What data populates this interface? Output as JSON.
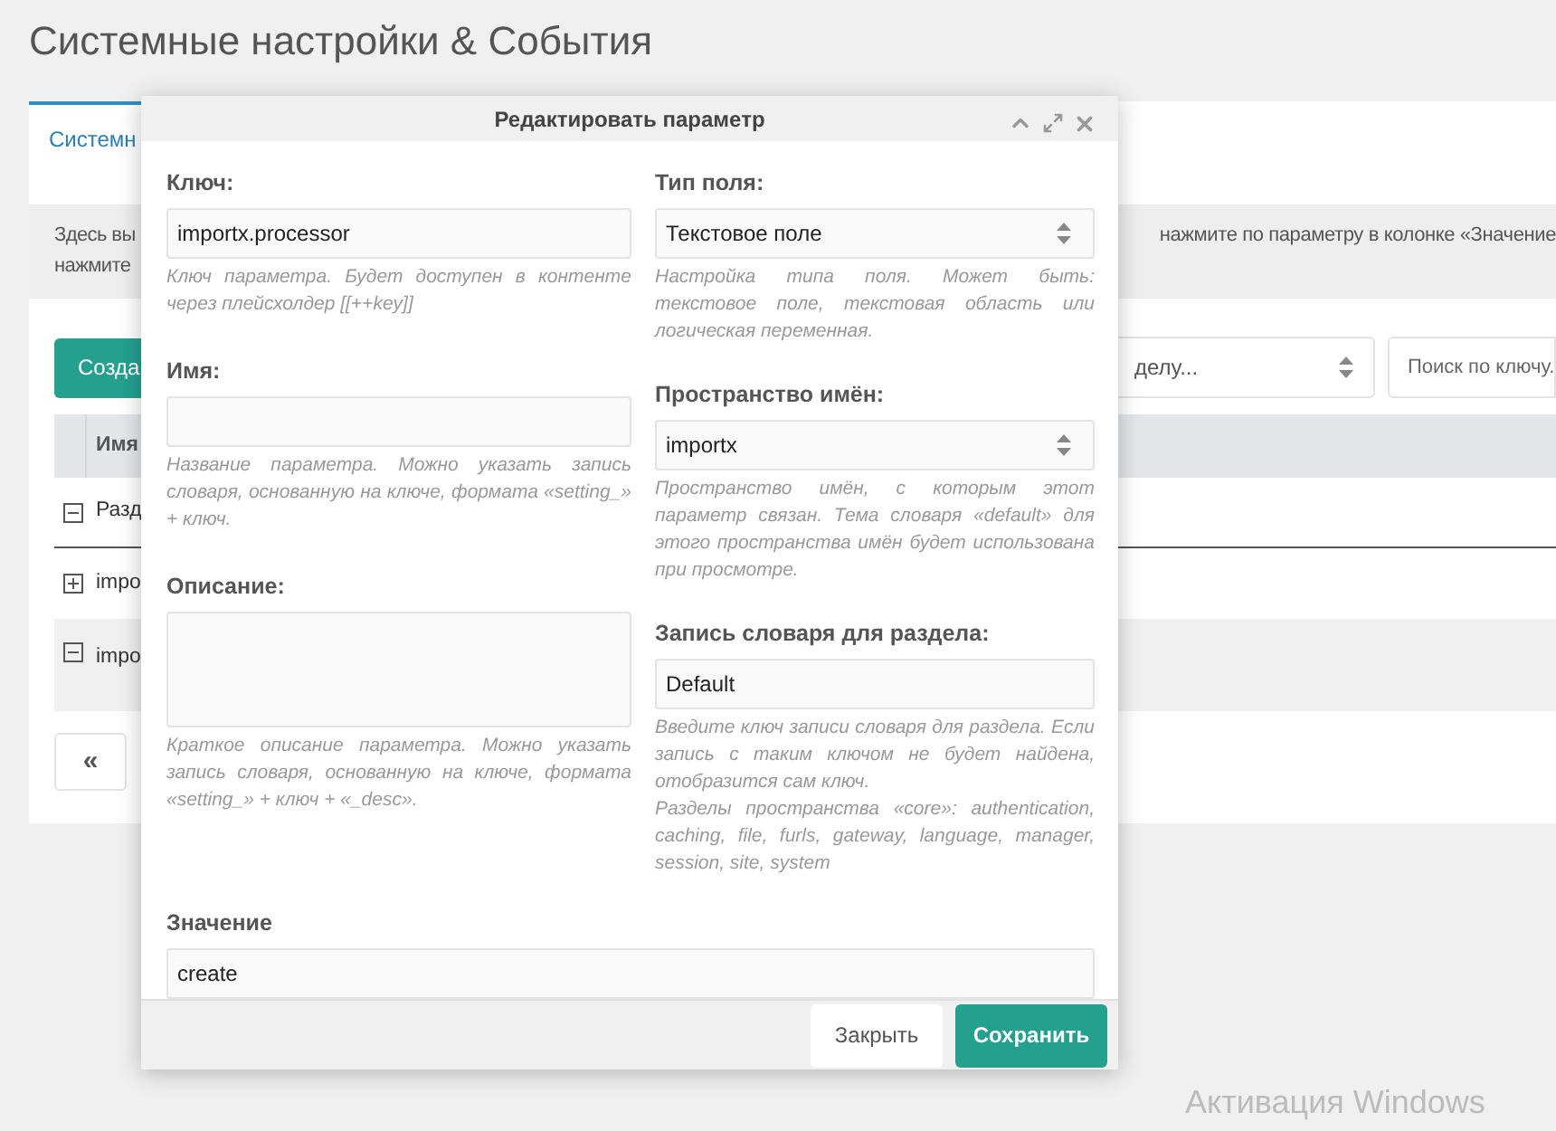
{
  "page": {
    "title": "Системные настройки & События"
  },
  "tabs": [
    {
      "label": "Системн",
      "selected": true
    }
  ],
  "description": {
    "left_lines": [
      "Здесь вы",
      "нажмите"
    ],
    "right_text": "нажмите по параметру в колонке «Значение"
  },
  "toolbar": {
    "create_button": "Созда",
    "section_select": "делу...",
    "search_placeholder": "Поиск по ключу."
  },
  "grid": {
    "columns": [
      "Имя"
    ],
    "rows": [
      {
        "label": "Разд",
        "expanded": true,
        "selected": false
      },
      {
        "label": "impo",
        "expanded": false,
        "selected": false
      },
      {
        "label": "impo",
        "expanded": true,
        "selected": true
      }
    ]
  },
  "pager": {
    "first_button": "«"
  },
  "modal": {
    "title": "Редактировать параметр",
    "left_fields": [
      {
        "label": "Ключ:",
        "kind": "input",
        "value": "importx.processor",
        "help": [
          "Ключ параметра. Будет доступен в контенте через плейсхолдер [[++key]]"
        ]
      },
      {
        "label": "Имя:",
        "kind": "input",
        "help": [
          "Название параметра. Можно указать запись словаря, основанную на ключе, формата «setting_» + ключ."
        ]
      },
      {
        "label": "Описание:",
        "kind": "textarea",
        "help": [
          "Краткое описание параметра. Можно указать запись словаря, основанную на ключе, формата «setting_» + ключ + «_desc»."
        ]
      }
    ],
    "right_fields": [
      {
        "label": "Тип поля:",
        "kind": "select",
        "value": "Текстовое поле",
        "help": [
          "Настройка типа поля. Может быть: текстовое поле, текстовая область или логическая переменная."
        ]
      },
      {
        "label": "Пространство имён:",
        "kind": "select",
        "value": "importx",
        "help": [
          "Пространство имён, с которым этот параметр связан. Тема словаря «default» для этого пространства имён будет использована при просмотре."
        ]
      },
      {
        "label": "Запись словаря для раздела:",
        "kind": "input",
        "value": "Default",
        "help": [
          "Введите ключ записи словаря для раздела. Если запись с таким ключом не будет найдена, отобразится сам ключ.",
          "Разделы пространства «core»: authentication, caching, file, furls, gateway, language, manager, session, site, system"
        ]
      }
    ],
    "value_field": {
      "label": "Значение",
      "value": "create"
    },
    "buttons": [
      {
        "label": "Закрыть",
        "kind": "secondary"
      },
      {
        "label": "Сохранить",
        "kind": "primary"
      }
    ]
  },
  "os_notice": "Активация Windows"
}
